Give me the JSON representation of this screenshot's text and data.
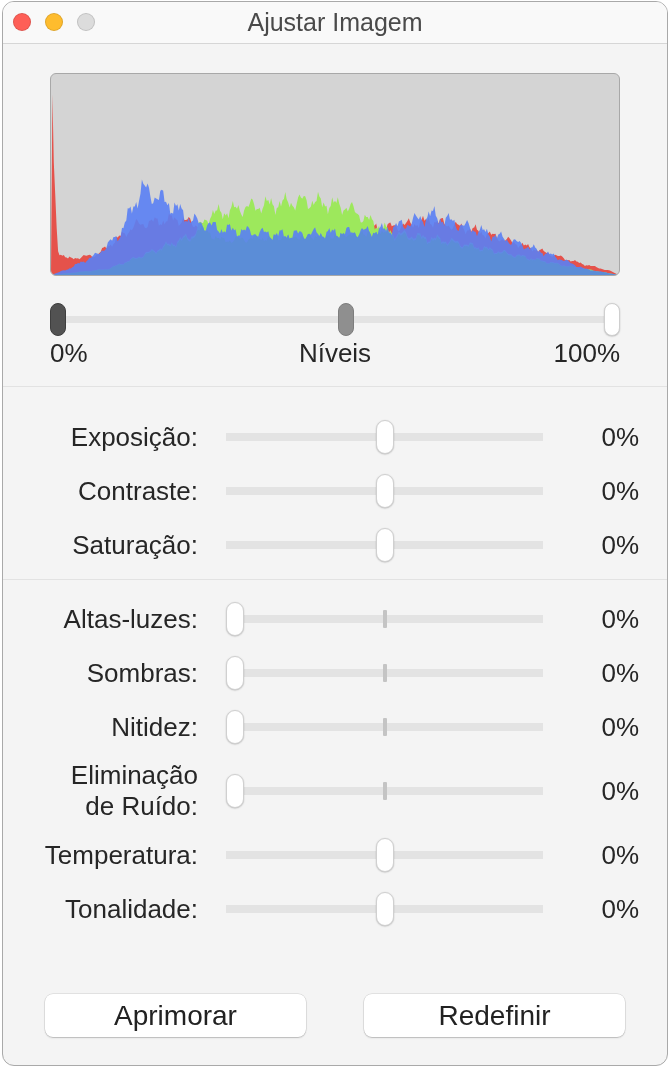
{
  "window": {
    "title": "Ajustar Imagem",
    "controls": [
      {
        "kind": "close",
        "disabled": false
      },
      {
        "kind": "minimize",
        "disabled": false
      },
      {
        "kind": "zoom",
        "disabled": true
      }
    ]
  },
  "levels": {
    "label": "Níveis",
    "min_label": "0%",
    "max_label": "100%",
    "thumbs": [
      {
        "kind": "black_point",
        "level": 0
      },
      {
        "kind": "gamma",
        "level": 0.52
      },
      {
        "kind": "white_point",
        "level": 1
      }
    ]
  },
  "sections": [
    {
      "sliders": [
        {
          "label": "Exposição:",
          "level": 0.5,
          "value": "0%"
        },
        {
          "label": "Contraste:",
          "level": 0.5,
          "value": "0%"
        },
        {
          "label": "Saturação:",
          "level": 0.5,
          "value": "0%"
        }
      ]
    },
    {
      "sliders": [
        {
          "label": "Altas-luzes:",
          "level": 0,
          "center_tick": true,
          "value": "0%"
        },
        {
          "label": "Sombras:",
          "level": 0,
          "center_tick": true,
          "value": "0%"
        },
        {
          "label": "Nitidez:",
          "level": 0,
          "center_tick": true,
          "value": "0%"
        },
        {
          "label": "Eliminação\nde Ruído:",
          "level": 0,
          "center_tick": true,
          "value": "0%"
        },
        {
          "label": "Temperatura:",
          "level": 0.5,
          "value": "0%"
        },
        {
          "label": "Tonalidade:",
          "level": 0.5,
          "value": "0%"
        }
      ]
    }
  ],
  "buttons": [
    {
      "label": "Aprimorar"
    },
    {
      "label": "Redefinir"
    }
  ]
}
